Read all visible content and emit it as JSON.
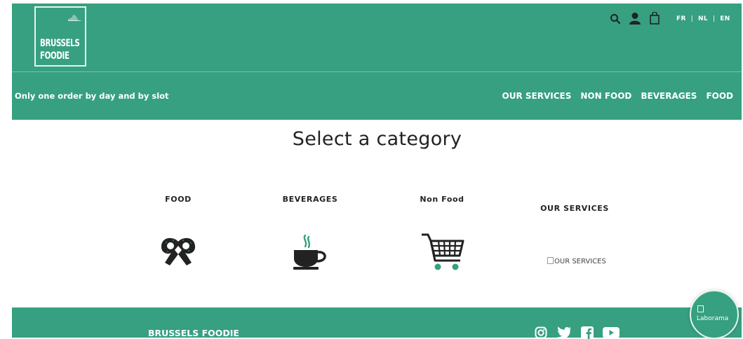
{
  "header": {
    "logo_line1": "BRUSSELS",
    "logo_line2": "FOODIE",
    "languages": [
      "FR",
      "NL",
      "EN"
    ],
    "language_separator": "|",
    "icons": [
      "search-icon",
      "user-icon",
      "bag-icon"
    ],
    "tagline": "Only one order by day and by slot",
    "nav": [
      "OUR SERVICES",
      "NON FOOD",
      "BEVERAGES",
      "FOOD"
    ]
  },
  "main": {
    "title": "Select a category",
    "categories": [
      {
        "label": "FOOD",
        "icon": "pretzel-icon"
      },
      {
        "label": "BEVERAGES",
        "icon": "coffee-cup-icon"
      },
      {
        "label": "Non Food",
        "icon": "shopping-cart-icon"
      },
      {
        "label": "OUR SERVICES",
        "icon": "broken-image",
        "alt": "OUR SERVICES"
      }
    ]
  },
  "footer": {
    "brand": "BRUSSELS FOODIE",
    "social": [
      "instagram-icon",
      "twitter-icon",
      "facebook-icon",
      "youtube-icon"
    ]
  },
  "widget": {
    "alt": "Laborama"
  },
  "colors": {
    "brand_green": "#36a080",
    "icon_dark": "#222222",
    "accent_green": "#36a080"
  }
}
